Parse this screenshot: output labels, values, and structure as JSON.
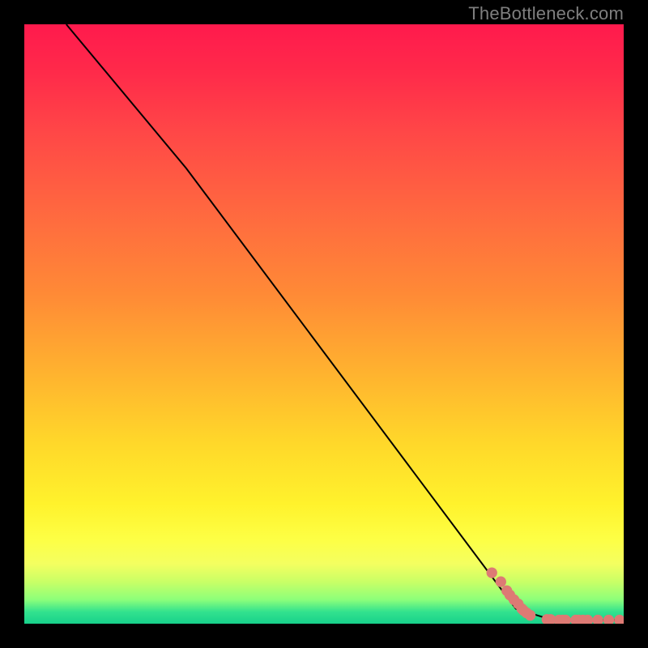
{
  "watermark": "TheBottleneck.com",
  "chart_data": {
    "type": "line",
    "title": "",
    "xlabel": "",
    "ylabel": "",
    "xlim": [
      0,
      100
    ],
    "ylim": [
      0,
      100
    ],
    "grid": false,
    "legend": false,
    "background_gradient": {
      "direction": "vertical",
      "stops": [
        {
          "pct": 0,
          "color": "#ff1a4d"
        },
        {
          "pct": 18,
          "color": "#ff4747"
        },
        {
          "pct": 45,
          "color": "#ff8a36"
        },
        {
          "pct": 70,
          "color": "#ffd82a"
        },
        {
          "pct": 86,
          "color": "#fdff45"
        },
        {
          "pct": 96,
          "color": "#8cff7a"
        },
        {
          "pct": 100,
          "color": "#17d18b"
        }
      ]
    },
    "series": [
      {
        "name": "curve",
        "style": "line",
        "color": "#000000",
        "x": [
          7,
          27,
          82,
          87.5,
          90,
          100
        ],
        "y": [
          100,
          76,
          2.5,
          0.8,
          0.6,
          0.6
        ]
      },
      {
        "name": "points",
        "style": "scatter",
        "color": "#dd7a74",
        "marker_radius_pct": 0.9,
        "x": [
          78,
          79.5,
          80.5,
          81,
          81.7,
          82.4,
          83,
          83.3,
          83.8,
          84.4,
          87.2,
          87.8,
          89.2,
          89.8,
          90.3,
          92,
          92.5,
          93.2,
          94,
          95.7,
          97.5,
          99.3
        ],
        "y": [
          8.5,
          7.0,
          5.5,
          4.8,
          4.0,
          3.3,
          2.5,
          2.2,
          1.8,
          1.4,
          0.7,
          0.7,
          0.6,
          0.6,
          0.6,
          0.6,
          0.6,
          0.6,
          0.6,
          0.6,
          0.6,
          0.6
        ]
      }
    ]
  },
  "gradient_note": "Plot area background transitions red (top, high bottleneck) → green (bottom, low bottleneck); black line + salmon dots overlay."
}
